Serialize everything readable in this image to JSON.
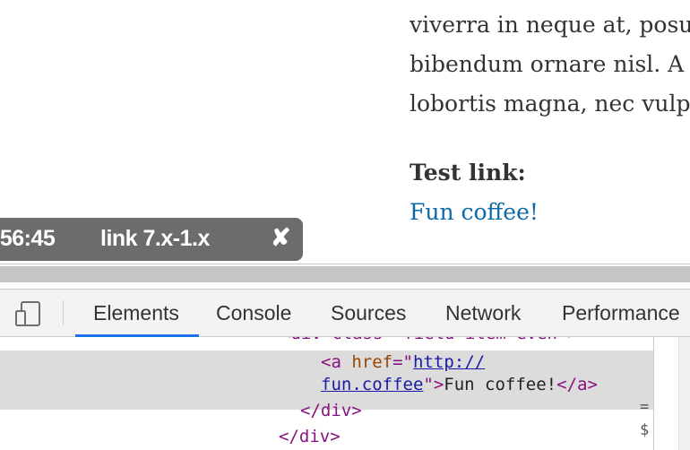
{
  "page": {
    "body_lines": [
      "viverra in neque at, posu",
      "bibendum ornare nisl. A",
      "lobortis magna, nec vulp"
    ],
    "test_heading": "Test link:",
    "test_link_text": "Fun coffee!",
    "link_color": "#0c6aa8"
  },
  "toolbar": {
    "time_text": ":56:45",
    "version_text": "link 7.x-1.x",
    "close_glyph": "✘"
  },
  "devtools": {
    "tabs": [
      {
        "label": "Elements",
        "active": true
      },
      {
        "label": "Console",
        "active": false
      },
      {
        "label": "Sources",
        "active": false
      },
      {
        "label": "Network",
        "active": false
      },
      {
        "label": "Performance",
        "active": false
      }
    ],
    "accent": "#1a73e8"
  },
  "elements": {
    "cut_line": "<div class=\"field-item even\">",
    "a_open": "<a",
    "href_attr": "href",
    "eq_quote": "=\"",
    "href_part1": "http://",
    "href_part2": "fun.coffee",
    "close_quote": "\">",
    "link_text": "Fun coffee!",
    "a_close": "</a>",
    "div_close_1": "</div>",
    "div_close_2": "</div>"
  },
  "side": {
    "marker_eq": "=",
    "marker_dollar": "$"
  }
}
